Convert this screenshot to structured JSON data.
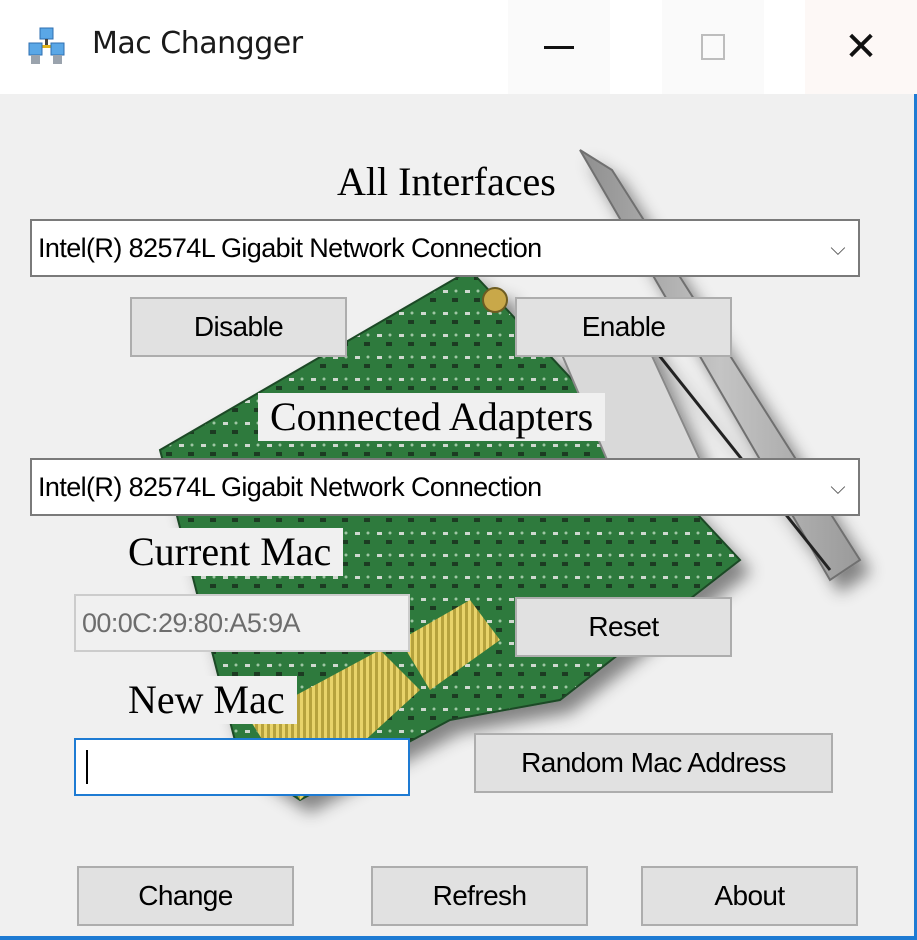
{
  "window": {
    "title": "Mac Changger",
    "icon": "network-computers-icon",
    "controls": {
      "minimize": "minimize-icon",
      "maximize": "maximize-icon",
      "close": "close-icon"
    },
    "accent_color": "#1e7bd3"
  },
  "all_interfaces": {
    "label": "All Interfaces",
    "selected": "Intel(R) 82574L Gigabit Network Connection",
    "disable_label": "Disable",
    "enable_label": "Enable"
  },
  "connected_adapters": {
    "label": "Connected Adapters",
    "selected": "Intel(R) 82574L Gigabit Network Connection"
  },
  "current_mac": {
    "label": "Current Mac",
    "value": "00:0C:29:80:A5:9A",
    "reset_label": "Reset"
  },
  "new_mac": {
    "label": "New Mac",
    "value": "",
    "random_label": "Random Mac Address"
  },
  "footer": {
    "change_label": "Change",
    "refresh_label": "Refresh",
    "about_label": "About"
  },
  "background_image": "network-card-pcb-image"
}
